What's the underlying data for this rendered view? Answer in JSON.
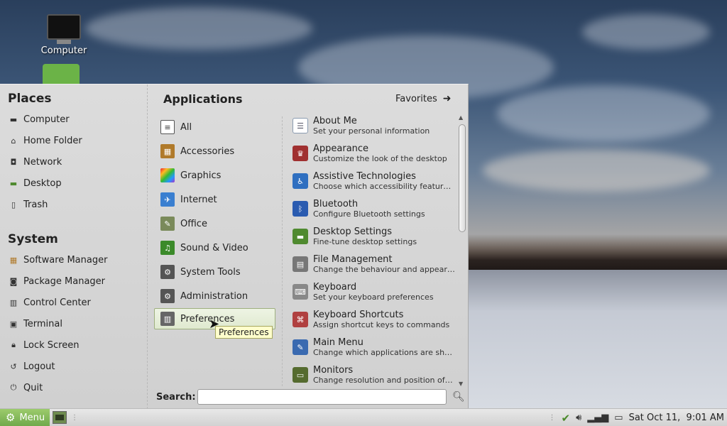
{
  "desktop": {
    "icons": [
      {
        "label": "Computer",
        "icon": "monitor-icon"
      },
      {
        "label": "",
        "icon": "home-folder-icon"
      }
    ]
  },
  "menu": {
    "places_title": "Places",
    "places": [
      {
        "label": "Computer",
        "icon": "computer-icon"
      },
      {
        "label": "Home Folder",
        "icon": "home-icon"
      },
      {
        "label": "Network",
        "icon": "network-icon"
      },
      {
        "label": "Desktop",
        "icon": "desktop-icon"
      },
      {
        "label": "Trash",
        "icon": "trash-icon"
      }
    ],
    "system_title": "System",
    "system": [
      {
        "label": "Software Manager",
        "icon": "software-manager-icon"
      },
      {
        "label": "Package Manager",
        "icon": "package-manager-icon"
      },
      {
        "label": "Control Center",
        "icon": "control-center-icon"
      },
      {
        "label": "Terminal",
        "icon": "terminal-icon"
      },
      {
        "label": "Lock Screen",
        "icon": "lock-icon"
      },
      {
        "label": "Logout",
        "icon": "logout-icon"
      },
      {
        "label": "Quit",
        "icon": "power-icon"
      }
    ],
    "applications_title": "Applications",
    "favorites_label": "Favorites",
    "categories": [
      {
        "label": "All",
        "color": "#555555"
      },
      {
        "label": "Accessories",
        "color": "#b07a2a"
      },
      {
        "label": "Graphics",
        "color": "#c0399a"
      },
      {
        "label": "Internet",
        "color": "#3a7fd0"
      },
      {
        "label": "Office",
        "color": "#7a8a5a"
      },
      {
        "label": "Sound & Video",
        "color": "#3b8a2a"
      },
      {
        "label": "System Tools",
        "color": "#555555"
      },
      {
        "label": "Administration",
        "color": "#555555"
      },
      {
        "label": "Preferences",
        "color": "#666666"
      }
    ],
    "selected_category": "Preferences",
    "apps": [
      {
        "name": "About Me",
        "desc": "Set your personal information",
        "color": "#8a9bb0"
      },
      {
        "name": "Appearance",
        "desc": "Customize the look of the desktop",
        "color": "#a03030"
      },
      {
        "name": "Assistive Technologies",
        "desc": "Choose which accessibility features t...",
        "color": "#2f6fc0"
      },
      {
        "name": "Bluetooth",
        "desc": "Configure Bluetooth settings",
        "color": "#2a5bb0"
      },
      {
        "name": "Desktop Settings",
        "desc": "Fine-tune desktop settings",
        "color": "#4f8a2f"
      },
      {
        "name": "File Management",
        "desc": "Change the behaviour and appearanc...",
        "color": "#777777"
      },
      {
        "name": "Keyboard",
        "desc": "Set your keyboard preferences",
        "color": "#888888"
      },
      {
        "name": "Keyboard Shortcuts",
        "desc": "Assign shortcut keys to commands",
        "color": "#b04040"
      },
      {
        "name": "Main Menu",
        "desc": "Change which applications are shown...",
        "color": "#3a6ab0"
      },
      {
        "name": "Monitors",
        "desc": "Change resolution and position of mo...",
        "color": "#556b2f"
      }
    ],
    "tooltip": "Preferences",
    "search_label": "Search:",
    "search_value": "",
    "search_placeholder": ""
  },
  "panel": {
    "menu_label": "Menu",
    "clock": "Sat Oct 11,  9:01 AM",
    "tray_icons": [
      "shield-icon",
      "volume-icon",
      "signal-icon",
      "battery-icon"
    ]
  }
}
